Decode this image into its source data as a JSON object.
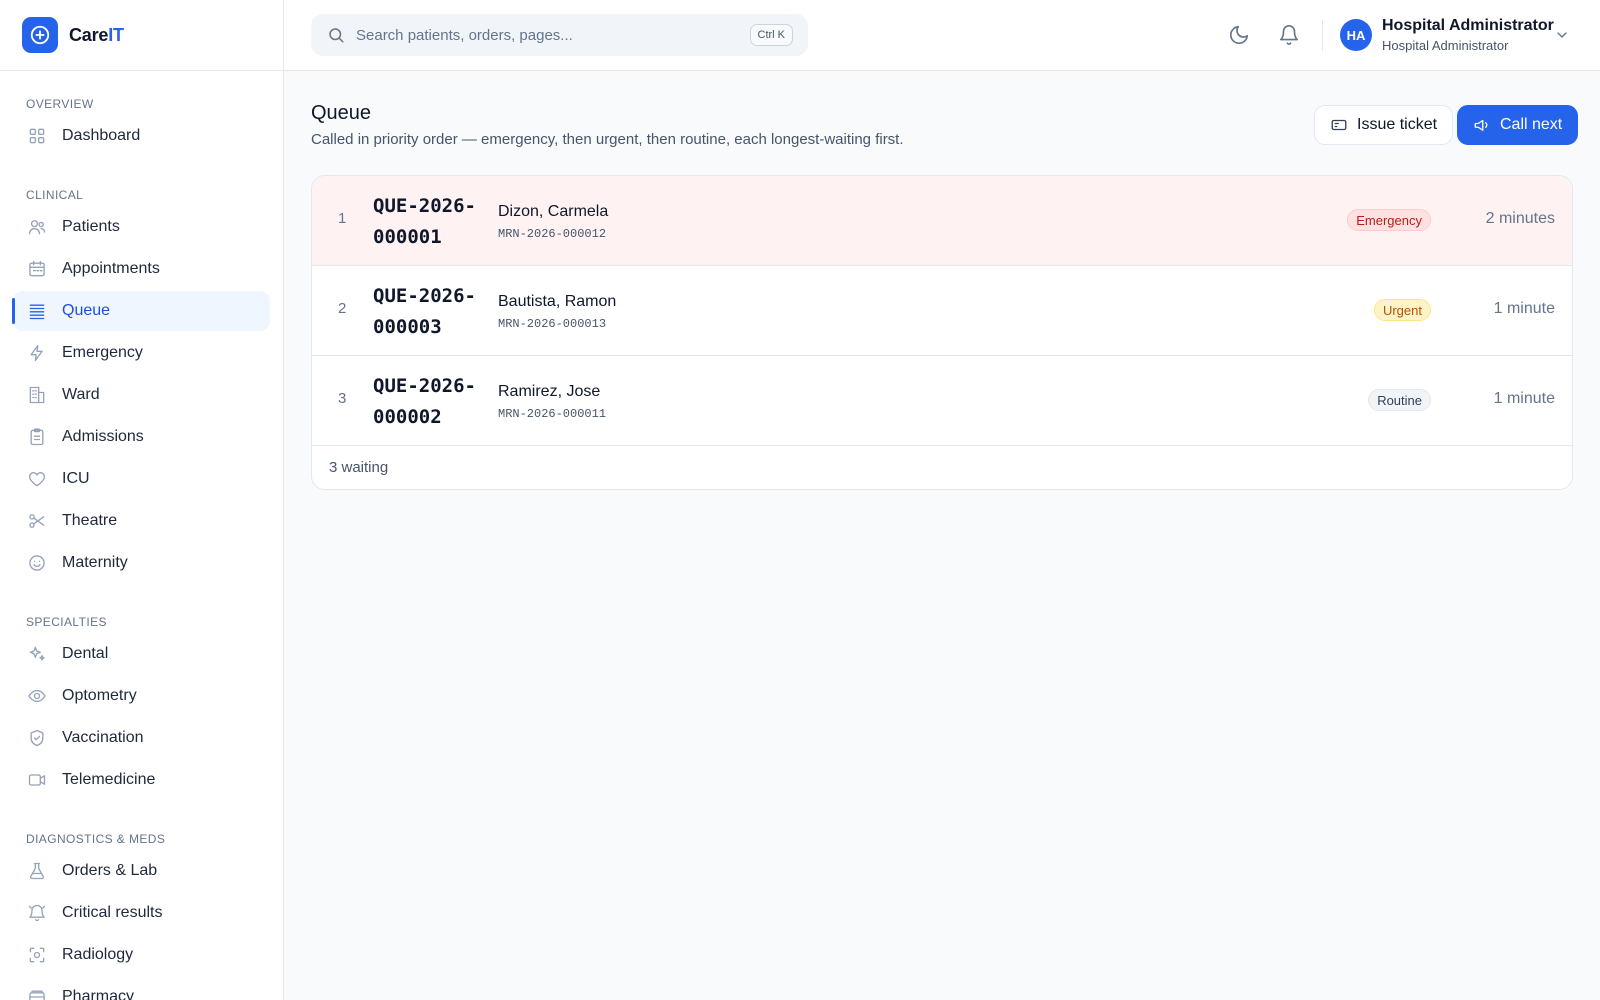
{
  "brand": {
    "name_main": "Care",
    "name_accent": "IT"
  },
  "sidebar": {
    "sections": [
      {
        "title": "OVERVIEW",
        "items": [
          {
            "label": "Dashboard",
            "icon": "dashboard-icon"
          }
        ]
      },
      {
        "title": "CLINICAL",
        "items": [
          {
            "label": "Patients",
            "icon": "users-icon"
          },
          {
            "label": "Appointments",
            "icon": "calendar-icon"
          },
          {
            "label": "Queue",
            "icon": "list-icon",
            "active": true
          },
          {
            "label": "Emergency",
            "icon": "bolt-icon"
          },
          {
            "label": "Ward",
            "icon": "building-icon"
          },
          {
            "label": "Admissions",
            "icon": "clipboard-icon"
          },
          {
            "label": "ICU",
            "icon": "heart-icon"
          },
          {
            "label": "Theatre",
            "icon": "scissors-icon"
          },
          {
            "label": "Maternity",
            "icon": "smile-icon"
          }
        ]
      },
      {
        "title": "SPECIALTIES",
        "items": [
          {
            "label": "Dental",
            "icon": "sparkles-icon"
          },
          {
            "label": "Optometry",
            "icon": "eye-icon"
          },
          {
            "label": "Vaccination",
            "icon": "shield-check-icon"
          },
          {
            "label": "Telemedicine",
            "icon": "video-icon"
          }
        ]
      },
      {
        "title": "DIAGNOSTICS & MEDS",
        "items": [
          {
            "label": "Orders & Lab",
            "icon": "flask-icon"
          },
          {
            "label": "Critical results",
            "icon": "bell-alert-icon"
          },
          {
            "label": "Radiology",
            "icon": "scan-icon"
          },
          {
            "label": "Pharmacy",
            "icon": "pill-box-icon"
          }
        ]
      }
    ]
  },
  "topbar": {
    "search_placeholder": "Search patients, orders, pages...",
    "search_shortcut": "Ctrl K",
    "user_initials": "HA",
    "user_name": "Hospital Administrator",
    "user_role": "Hospital Administrator"
  },
  "page": {
    "title": "Queue",
    "subtitle": "Called in priority order — emergency, then urgent, then routine, each longest-waiting first.",
    "issue_ticket_label": "Issue ticket",
    "call_next_label": "Call next"
  },
  "queue": {
    "rows": [
      {
        "position": "1",
        "ticket": "QUE-2026-000001",
        "patient": "Dizon, Carmela",
        "mrn": "MRN-2026-000012",
        "priority": "Emergency",
        "priority_key": "emergency",
        "waiting": "2 minutes"
      },
      {
        "position": "2",
        "ticket": "QUE-2026-000003",
        "patient": "Bautista, Ramon",
        "mrn": "MRN-2026-000013",
        "priority": "Urgent",
        "priority_key": "urgent",
        "waiting": "1 minute"
      },
      {
        "position": "3",
        "ticket": "QUE-2026-000002",
        "patient": "Ramirez, Jose",
        "mrn": "MRN-2026-000011",
        "priority": "Routine",
        "priority_key": "routine",
        "waiting": "1 minute"
      }
    ],
    "footer": "3 waiting"
  },
  "colors": {
    "accent": "#2563eb",
    "emergency_row": "#fef2f2"
  }
}
